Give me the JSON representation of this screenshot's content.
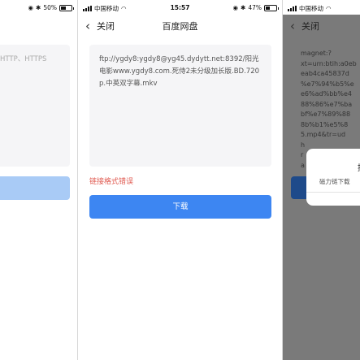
{
  "panel1": {
    "status": {
      "battery": "50%"
    },
    "placeholder": "HTTP、HTTPS"
  },
  "panel2": {
    "status": {
      "carrier": "中国移动",
      "time": "15:57",
      "battery": "47%"
    },
    "nav": {
      "close": "关闭",
      "title": "百度网盘"
    },
    "link_text": "ftp://ygdy8:ygdy8@yg45.dydytt.net:8392/阳光电影www.ygdy8.com.死侍2未分级加长版.BD.720p.中英双字幕.mkv",
    "error": "链接格式错误",
    "download_button": "下载"
  },
  "panel3": {
    "status": {
      "carrier": "中国移动"
    },
    "nav": {
      "close": "关闭"
    },
    "link_lines": [
      "magnet:?",
      "xt=urn:btih:a0eb",
      "eab4ca45837d",
      "%e7%94%b5%e",
      "e6%ad%bb%e4",
      "88%86%e7%ba",
      "bf%e7%89%88",
      "8b%b1%e5%8",
      "5.mp4&tr=ud",
      "h",
      "r",
      "a"
    ],
    "dialog_title": "提",
    "dialog_message": "磁力链下载"
  },
  "colors": {
    "accent": "#3d86f2",
    "error": "#e05a50",
    "overlay": "#7a7a7a"
  }
}
